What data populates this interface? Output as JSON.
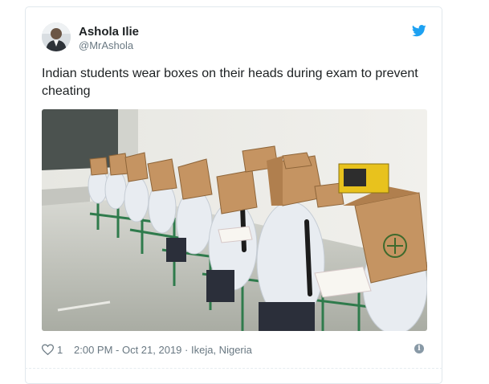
{
  "tweet": {
    "display_name": "Ashola Ilie",
    "handle": "@MrAshola",
    "text": "Indian students wear boxes on their heads during exam to prevent cheating",
    "like_count": "1",
    "timestamp": "2:00 PM - Oct 21, 2019",
    "separator": "·",
    "location": "Ikeja, Nigeria"
  },
  "icons": {
    "brand": "twitter-bird-icon",
    "like": "heart-icon",
    "info": "info-icon"
  },
  "colors": {
    "brand_blue": "#1da1f2",
    "text": "#1c2022",
    "muted": "#697882",
    "border": "#e1e8ed"
  }
}
